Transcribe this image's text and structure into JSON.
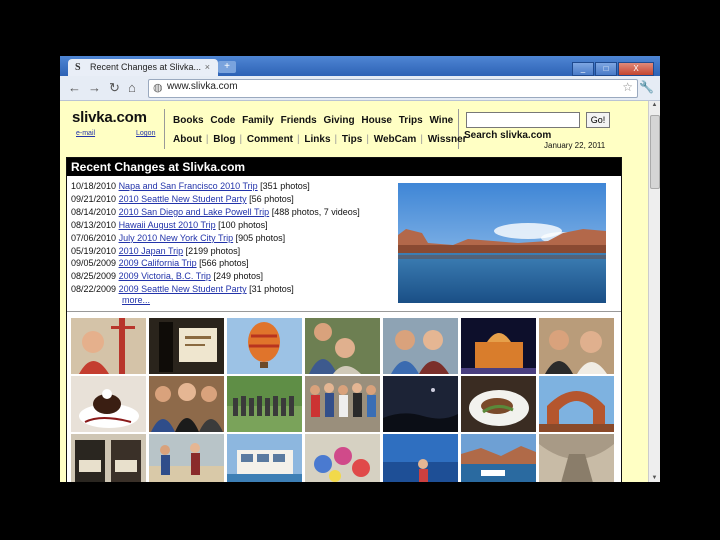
{
  "browser": {
    "tab_title": "Recent Changes at Slivka...",
    "tab_favicon": "S",
    "tab_close": "×",
    "new_tab": "+",
    "url": "www.slivka.com",
    "win_min": "_",
    "win_max": "□",
    "win_close": "X"
  },
  "site": {
    "logo": "slivka.com",
    "email_link": "e-mail",
    "logon_link": "Logon",
    "nav_top": [
      "Books",
      "Code",
      "Family",
      "Friends",
      "Giving",
      "House",
      "Trips",
      "Wine"
    ],
    "nav_bottom": [
      "About",
      "Blog",
      "Comment",
      "Links",
      "Tips",
      "WebCam",
      "Wissner"
    ],
    "go_label": "Go!",
    "search_label": "Search slivka.com",
    "date": "January 22, 2011"
  },
  "recent": {
    "header": "Recent Changes at Slivka.com",
    "items": [
      {
        "date": "10/18/2010",
        "link": "Napa and San Francisco 2010 Trip",
        "count": "[351 photos]"
      },
      {
        "date": "09/21/2010",
        "link": "2010 Seattle New Student Party",
        "count": "[56 photos]"
      },
      {
        "date": "08/14/2010",
        "link": "2010 San Diego and Lake Powell Trip",
        "count": "[488 photos, 7 videos]"
      },
      {
        "date": "08/13/2010",
        "link": "Hawaii August 2010 Trip",
        "count": "[100 photos]"
      },
      {
        "date": "07/06/2010",
        "link": "July 2010 New York City Trip",
        "count": "[905 photos]"
      },
      {
        "date": "05/19/2010",
        "link": "2010 Japan Trip",
        "count": "[2199 photos]"
      },
      {
        "date": "09/05/2009",
        "link": "2009 California Trip",
        "count": "[566 photos]"
      },
      {
        "date": "08/25/2009",
        "link": "2009 Victoria, B.C. Trip",
        "count": "[249 photos]"
      },
      {
        "date": "08/22/2009",
        "link": "2009 Seattle New Student Party",
        "count": "[31 photos]"
      }
    ],
    "more": "more..."
  }
}
